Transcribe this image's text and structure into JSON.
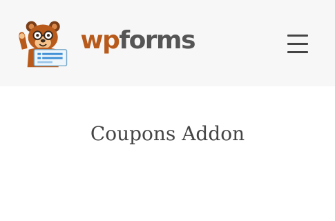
{
  "header": {
    "logo": {
      "text_wp": "wp",
      "text_forms": "forms",
      "icon": "wpforms-bear-mascot-icon"
    },
    "menu": {
      "icon": "hamburger-menu-icon"
    }
  },
  "main": {
    "title": "Coupons Addon"
  },
  "colors": {
    "header_bg": "#f7f7f7",
    "brand_orange": "#b85a1b",
    "text_gray": "#555555"
  }
}
